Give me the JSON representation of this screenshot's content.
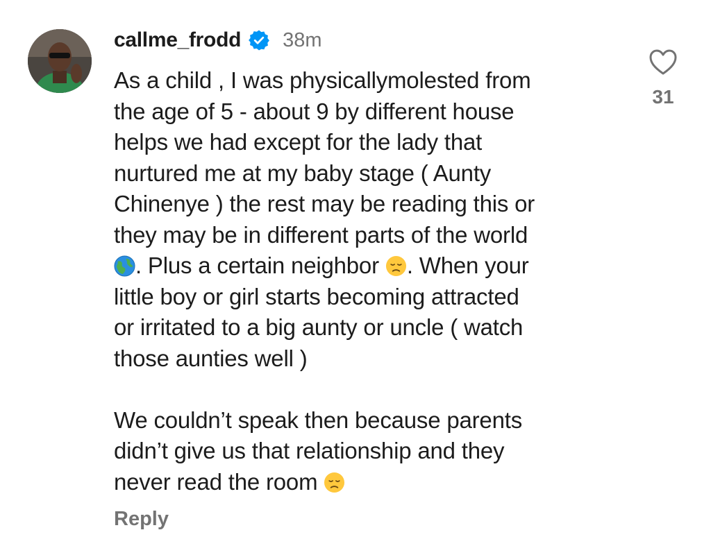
{
  "comment": {
    "username": "callme_frodd",
    "time_ago": "38m",
    "verified": true,
    "avatar_icon": "user-avatar-photo",
    "lines": {
      "l1": "As a child , I was physicallymolested from",
      "l2": "the age of 5 - about 9 by different house",
      "l3": "helps we had except for the lady that",
      "l4": "nurtured me at my baby stage ( Aunty",
      "l5": "Chinenye ) the rest may be reading this or",
      "l6": "they may be in different parts of the world",
      "l7a": ". Plus a certain neighbor ",
      "l7b": ". When your",
      "l8": "little boy or girl  starts becoming attracted",
      "l9": "or irritated to a big aunty or uncle ( watch",
      "l10": "those aunties well )",
      "l11": "We couldn’t speak then because parents",
      "l12": "didn’t give us that relationship and they",
      "l13": "never read the room "
    },
    "emoji": {
      "globe": "globe-emoji",
      "disappointed": "disappointed-face-emoji"
    },
    "reply_label": "Reply",
    "like_count": "31",
    "colors": {
      "text": "#1c1c1c",
      "secondary": "#737373",
      "verified_blue": "#0095f6",
      "background": "#ffffff"
    }
  }
}
